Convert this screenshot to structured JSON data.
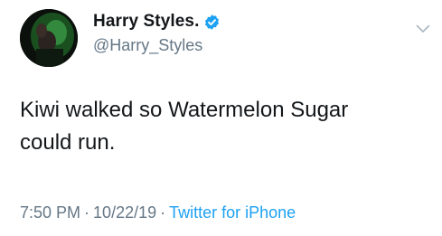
{
  "author": {
    "display_name": "Harry Styles.",
    "handle": "@Harry_Styles",
    "verified": true,
    "avatar_icon": "avatar-photo"
  },
  "tweet": {
    "text_line1": "Kiwi walked so Watermelon Sugar",
    "text_line2": "could run."
  },
  "meta": {
    "time": "7:50 PM",
    "separator": "·",
    "date": "10/22/19",
    "source": "Twitter for iPhone"
  },
  "icons": {
    "verified": "verified-badge-icon",
    "menu": "chevron-down-icon"
  },
  "colors": {
    "text": "#14171a",
    "secondary": "#657786",
    "accent": "#1da1f2"
  }
}
